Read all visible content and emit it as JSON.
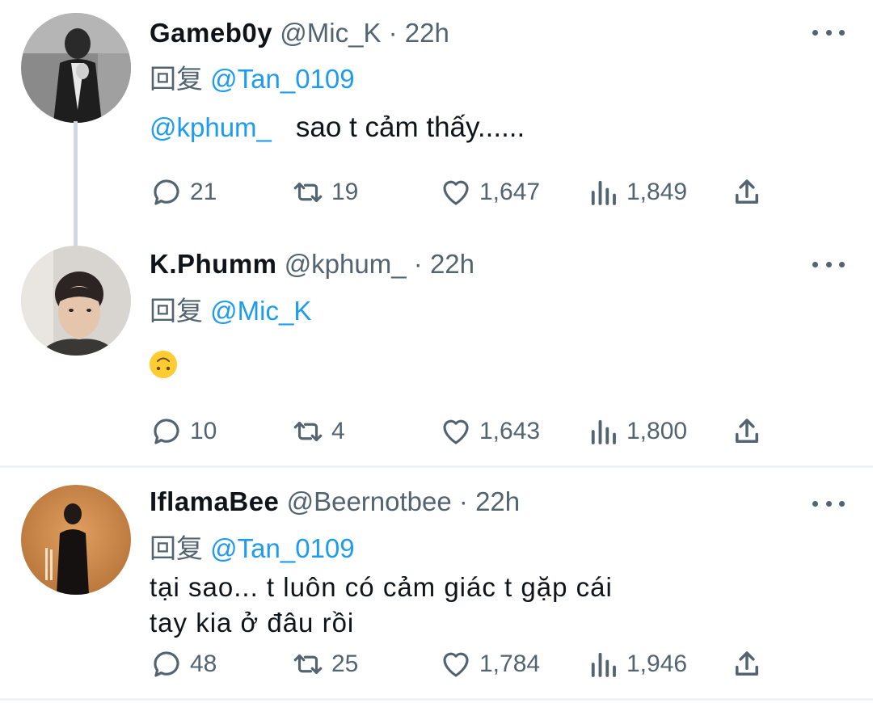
{
  "tweets": [
    {
      "name": "Gameb0y",
      "handle": "@Mic_K",
      "sep": "·",
      "time": "22h",
      "reply_prefix": "回复",
      "reply_to": "@Tan_0109",
      "body_mention": "@kphum_",
      "body_text": "sao t cảm thấy......",
      "replies": "21",
      "retweets": "19",
      "likes": "1,647",
      "views": "1,849"
    },
    {
      "name": "K.Phumm",
      "handle": "@kphum_",
      "sep": "·",
      "time": "22h",
      "reply_prefix": "回复",
      "reply_to": "@Mic_K",
      "body_emoji": "upside-down-face-emoji",
      "replies": "10",
      "retweets": "4",
      "likes": "1,643",
      "views": "1,800"
    },
    {
      "name": "IflamaBee",
      "handle": "@Beernotbee",
      "sep": "·",
      "time": "22h",
      "reply_prefix": "回复",
      "reply_to": "@Tan_0109",
      "body_line1": "tại sao... t luôn có cảm giác t gặp cái",
      "body_line2": "tay kia ở đâu rồi",
      "replies": "48",
      "retweets": "25",
      "likes": "1,784",
      "views": "1,946"
    }
  ],
  "colors": {
    "accent": "#1d9bf0",
    "secondary_text": "#536471",
    "primary_text": "#0f1419",
    "divider": "#eff3f4",
    "thread_line": "#cfd9de"
  }
}
